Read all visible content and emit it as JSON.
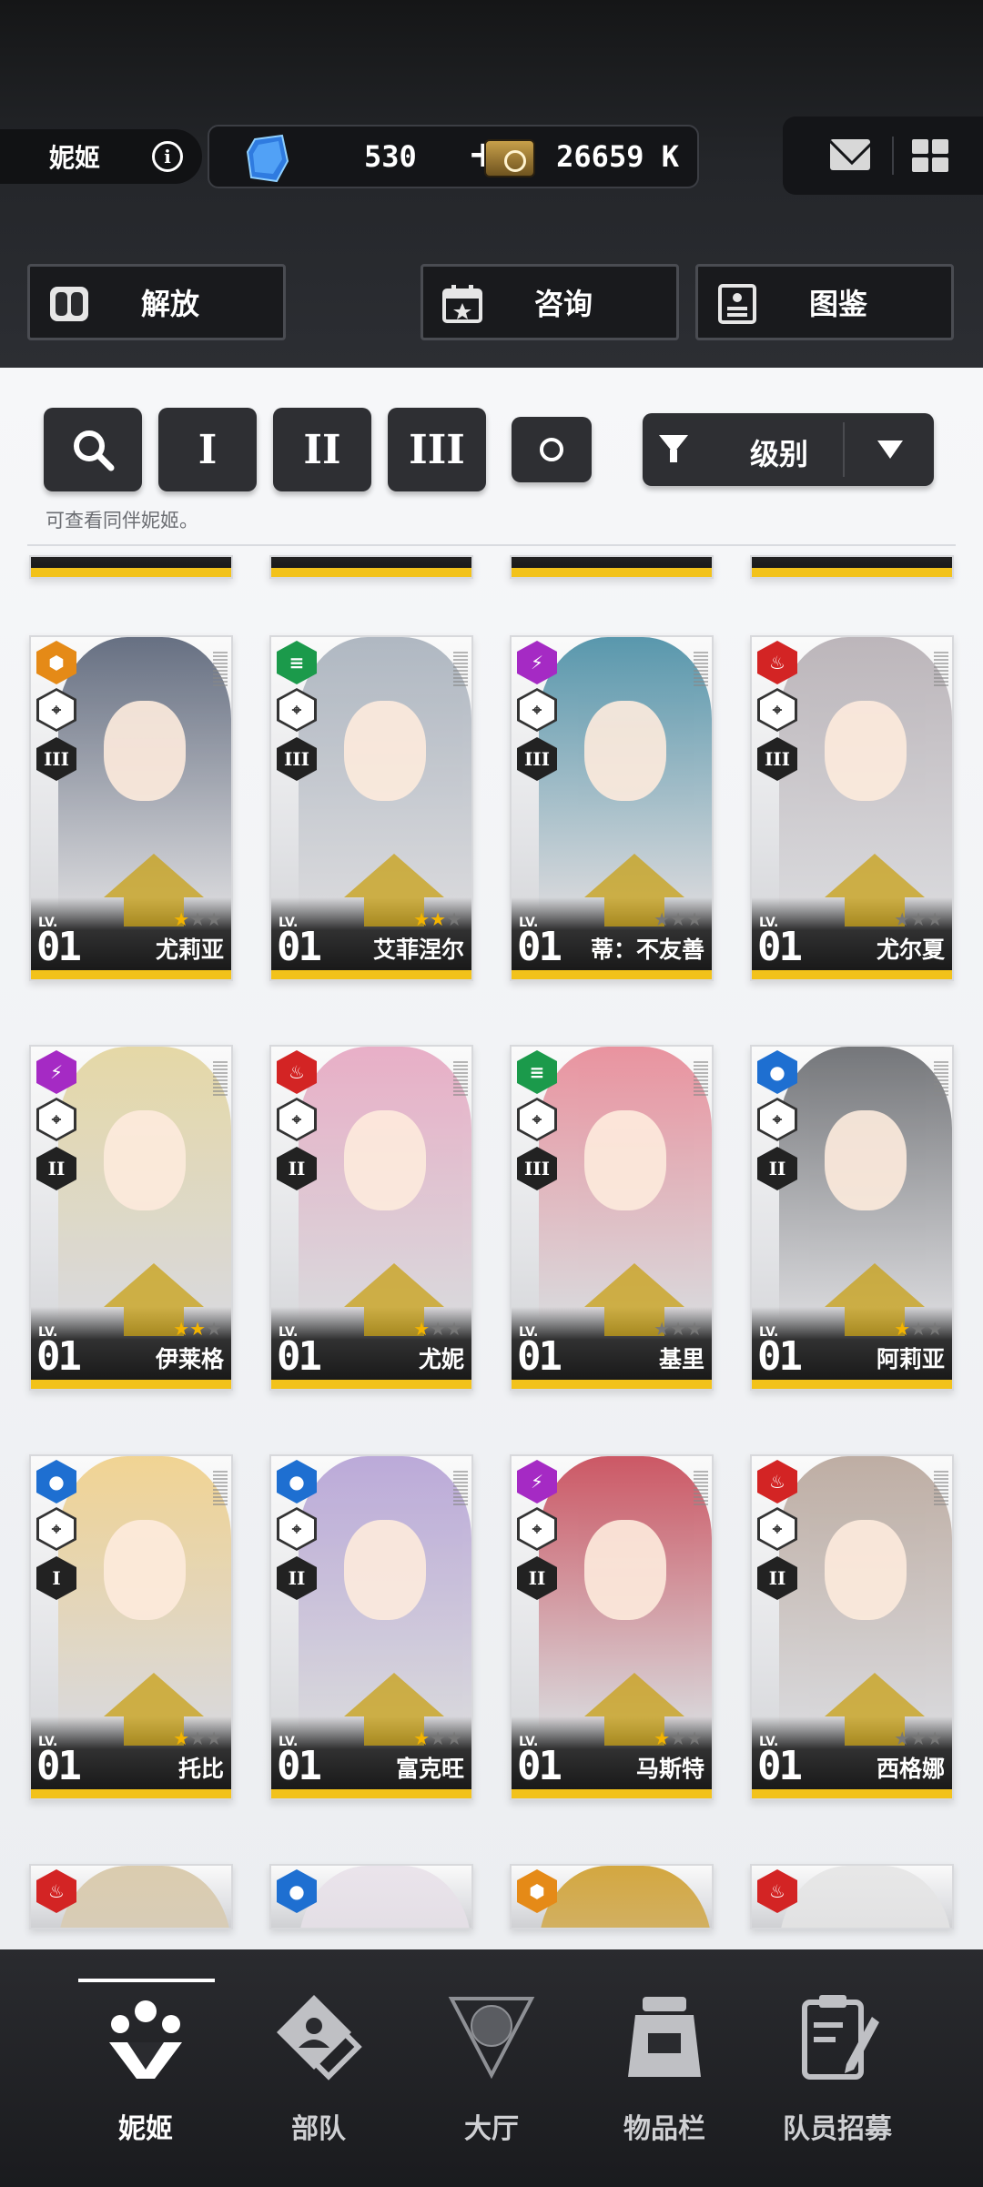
{
  "header": {
    "tab_title": "妮姬",
    "gem_value": "530",
    "gem_plus": "+",
    "credit_value": "26659 K"
  },
  "top_buttons": [
    {
      "label": "解放",
      "icon": "release-icon"
    },
    {
      "label": "咨询",
      "icon": "calendar-icon"
    },
    {
      "label": "图鉴",
      "icon": "codex-icon"
    }
  ],
  "filters": {
    "burst": [
      "I",
      "II",
      "III"
    ],
    "sort_label": "级别",
    "hint": "可查看同伴妮姬。"
  },
  "cards": [
    {
      "name": "尤莉亚",
      "level": "01",
      "lv_label": "LV.",
      "element": "iron",
      "burst": "III",
      "stars": 1,
      "color": "#5a6478"
    },
    {
      "name": "艾菲涅尔",
      "level": "01",
      "lv_label": "LV.",
      "element": "wind",
      "burst": "III",
      "stars": 2,
      "color": "#a9b2bd"
    },
    {
      "name": "蒂：不友善",
      "level": "01",
      "lv_label": "LV.",
      "element": "electric",
      "burst": "III",
      "stars": 0,
      "color": "#4b8fa6"
    },
    {
      "name": "尤尔夏",
      "level": "01",
      "lv_label": "LV.",
      "element": "fire",
      "burst": "III",
      "stars": 0,
      "color": "#b7b0b5"
    },
    {
      "name": "伊莱格",
      "level": "01",
      "lv_label": "LV.",
      "element": "electric",
      "burst": "II",
      "stars": 2,
      "color": "#e4d6a0"
    },
    {
      "name": "尤妮",
      "level": "01",
      "lv_label": "LV.",
      "element": "fire",
      "burst": "II",
      "stars": 1,
      "color": "#e7a9c3"
    },
    {
      "name": "基里",
      "level": "01",
      "lv_label": "LV.",
      "element": "wind",
      "burst": "III",
      "stars": 0,
      "color": "#e88b98"
    },
    {
      "name": "阿莉亚",
      "level": "01",
      "lv_label": "LV.",
      "element": "water",
      "burst": "II",
      "stars": 1,
      "color": "#6a6c70"
    },
    {
      "name": "托比",
      "level": "01",
      "lv_label": "LV.",
      "element": "water",
      "burst": "I",
      "stars": 1,
      "color": "#f0d08a"
    },
    {
      "name": "富克旺",
      "level": "01",
      "lv_label": "LV.",
      "element": "water",
      "burst": "II",
      "stars": 1,
      "color": "#b6a3d6"
    },
    {
      "name": "马斯特",
      "level": "01",
      "lv_label": "LV.",
      "element": "electric",
      "burst": "II",
      "stars": 1,
      "color": "#c84a58"
    },
    {
      "name": "西格娜",
      "level": "01",
      "lv_label": "LV.",
      "element": "fire",
      "burst": "II",
      "stars": 0,
      "color": "#b9a79c"
    }
  ],
  "partial_bottom_cards": [
    {
      "element": "fire",
      "color": "#d8c8a8"
    },
    {
      "element": "water",
      "color": "#e9e2ea"
    },
    {
      "element": "iron",
      "color": "#d0a030"
    },
    {
      "element": "fire",
      "color": "#e6e6e6"
    }
  ],
  "bottom_nav": [
    {
      "label": "妮姬",
      "icon": "nikke-icon",
      "active": true
    },
    {
      "label": "部队",
      "icon": "squad-icon",
      "active": false
    },
    {
      "label": "大厅",
      "icon": "lobby-icon",
      "active": false
    },
    {
      "label": "物品栏",
      "icon": "inventory-icon",
      "active": false
    },
    {
      "label": "队员招募",
      "icon": "recruit-icon",
      "active": false
    }
  ]
}
